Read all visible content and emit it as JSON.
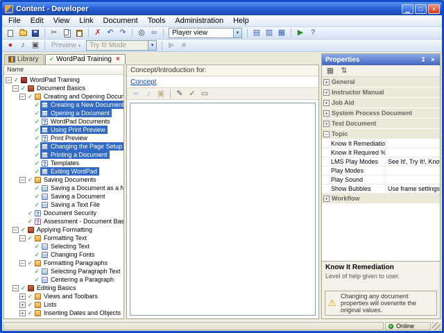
{
  "window": {
    "title": "Content - Developer",
    "controls": {
      "minimize": "▁",
      "maximize": "□",
      "close": "×"
    }
  },
  "colors": {
    "selection": "#316AC5",
    "title_blue": "#2B63D8",
    "online_green": "#2DB52D",
    "warning_yellow": "#E0A010"
  },
  "menu": {
    "items": [
      {
        "label": "File"
      },
      {
        "label": "Edit"
      },
      {
        "label": "View"
      },
      {
        "label": "Link"
      },
      {
        "label": "Document"
      },
      {
        "label": "Tools"
      },
      {
        "label": "Administration"
      },
      {
        "label": "Help"
      }
    ]
  },
  "toolbar_standard": {
    "items": [
      {
        "name": "new-document-icon",
        "shape": "page"
      },
      {
        "name": "open-icon",
        "shape": "folder"
      },
      {
        "name": "save-icon",
        "shape": "disk"
      },
      {
        "sep": true
      },
      {
        "name": "cut-icon",
        "glyph": "✂",
        "color": "#555555"
      },
      {
        "name": "copy-icon",
        "shape": "copy"
      },
      {
        "name": "paste-icon",
        "shape": "paste"
      },
      {
        "sep": true
      },
      {
        "name": "delete-icon",
        "glyph": "✗",
        "color": "#c03428"
      },
      {
        "name": "undo-icon",
        "glyph": "↶",
        "color": "#2a52be"
      },
      {
        "name": "redo-icon",
        "glyph": "↷",
        "color": "#2a52be"
      },
      {
        "sep": true
      },
      {
        "name": "find-icon",
        "glyph": "◎",
        "color": "#333333"
      },
      {
        "name": "link-icon",
        "glyph": "∞",
        "color": "#4a6fd4"
      },
      {
        "sep": true
      },
      {
        "combo": true,
        "name": "player-view-select",
        "value": "Player view",
        "width": 106
      },
      {
        "sep": true
      },
      {
        "name": "outline-view-icon",
        "glyph": "▤",
        "color": "#3a63b8"
      },
      {
        "name": "split-view-icon",
        "glyph": "▥",
        "color": "#3a63b8"
      },
      {
        "name": "grid-view-icon",
        "glyph": "▦",
        "color": "#3a63b8"
      },
      {
        "sep": true
      },
      {
        "name": "start-preview-icon",
        "glyph": "▶",
        "color": "#2f8a2f"
      },
      {
        "name": "help-icon",
        "glyph": "?",
        "color": "#2a52be"
      }
    ]
  },
  "toolbar_playback": {
    "items": [
      {
        "name": "record-topic-icon",
        "glyph": "●",
        "color": "#c03428"
      },
      {
        "name": "sound-recording-icon",
        "glyph": "♪",
        "color": "#2a52be"
      },
      {
        "name": "screenshot-icon",
        "glyph": "▣",
        "color": "#555555"
      },
      {
        "sep": true
      },
      {
        "labelbtn": true,
        "name": "preview-dropdown",
        "label": "Preview",
        "disabled": true
      },
      {
        "combo": true,
        "name": "play-mode-select",
        "value": "Try It! Mode",
        "width": 102,
        "disabled": true
      },
      {
        "sep": true
      },
      {
        "name": "play-icon",
        "glyph": "▶",
        "color": "#888888",
        "disabled": true
      },
      {
        "name": "stop-icon",
        "glyph": "■",
        "color": "#888888",
        "disabled": true
      }
    ]
  },
  "tabs": [
    {
      "label": "Library"
    },
    {
      "label": "WordPad Training"
    }
  ],
  "icons": {
    "check": "✓",
    "close": "×",
    "pin": "↧",
    "warning": "⚠"
  },
  "tree": {
    "header": "Name",
    "items": [
      {
        "label": "WordPad Training",
        "depth": 0,
        "toggle": "minus",
        "icon": "module",
        "check": true
      },
      {
        "label": "Document Basics",
        "depth": 1,
        "toggle": "minus",
        "icon": "section",
        "check": true
      },
      {
        "label": "Creating and Opening Documents",
        "depth": 2,
        "toggle": "minus",
        "icon": "lesson",
        "check": true
      },
      {
        "label": "Creating a New Document",
        "depth": 3,
        "icon": "topic",
        "check": true,
        "selected": true
      },
      {
        "label": "Opening a Document",
        "depth": 3,
        "icon": "topic",
        "check": true,
        "selected": true
      },
      {
        "label": "WordPad Documents",
        "depth": 3,
        "icon": "concept",
        "check": true
      },
      {
        "label": "Using Print Preview",
        "depth": 3,
        "icon": "topic",
        "check": true,
        "selected": true
      },
      {
        "label": "Print Preview",
        "depth": 3,
        "icon": "concept",
        "check": true
      },
      {
        "label": "Changing the Page Setup",
        "depth": 3,
        "icon": "topic",
        "check": true,
        "selected": true
      },
      {
        "label": "Printing a Document",
        "depth": 3,
        "icon": "topic",
        "check": true,
        "selected": true
      },
      {
        "label": "Templates",
        "depth": 3,
        "icon": "concept",
        "check": true
      },
      {
        "label": "Exiting WordPad",
        "depth": 3,
        "icon": "topic",
        "check": true,
        "selected": true
      },
      {
        "label": "Saving Documents",
        "depth": 2,
        "toggle": "minus",
        "icon": "lesson",
        "check": true
      },
      {
        "label": "Saving a Document as a New File",
        "depth": 3,
        "icon": "topic",
        "check": true
      },
      {
        "label": "Saving a Document",
        "depth": 3,
        "icon": "topic",
        "check": true
      },
      {
        "label": "Saving a Text File",
        "depth": 3,
        "icon": "topic",
        "check": true
      },
      {
        "label": "Document Security",
        "depth": 2,
        "icon": "concept",
        "check": true
      },
      {
        "label": "Assessment - Document Basics",
        "depth": 2,
        "icon": "assessment",
        "check": true
      },
      {
        "label": "Applying Formatting",
        "depth": 1,
        "toggle": "minus",
        "icon": "section",
        "check": true
      },
      {
        "label": "Formatting Text",
        "depth": 2,
        "toggle": "minus",
        "icon": "lesson",
        "check": true
      },
      {
        "label": "Selecting Text",
        "depth": 3,
        "icon": "topic",
        "check": true
      },
      {
        "label": "Changing Fonts",
        "depth": 3,
        "icon": "topic",
        "check": true
      },
      {
        "label": "Formatting Paragraphs",
        "depth": 2,
        "toggle": "minus",
        "icon": "lesson",
        "check": true
      },
      {
        "label": "Selecting Paragraph Text",
        "depth": 3,
        "icon": "topic",
        "check": true
      },
      {
        "label": "Centering a Paragraph",
        "depth": 3,
        "icon": "topic",
        "check": true
      },
      {
        "label": "Editing Basics",
        "depth": 1,
        "toggle": "minus",
        "icon": "section",
        "check": true
      },
      {
        "label": "Views and Toolbars",
        "depth": 2,
        "toggle": "plus",
        "icon": "lesson",
        "check": true
      },
      {
        "label": "Lists",
        "depth": 2,
        "toggle": "plus",
        "icon": "lesson",
        "check": true
      },
      {
        "label": "Inserting Dates and Objects",
        "depth": 2,
        "toggle": "plus",
        "icon": "lesson",
        "check": true
      }
    ]
  },
  "editor": {
    "header": "Concept/Introduction for:",
    "link": "Concept",
    "toolbar": [
      {
        "name": "insert-link-icon",
        "glyph": "∞",
        "color": "#4a6fd4",
        "disabled": true
      },
      {
        "name": "insert-sound-icon",
        "glyph": "♪",
        "color": "#2a52be",
        "disabled": true
      },
      {
        "name": "insert-image-icon",
        "glyph": "▣",
        "color": "#8a6a3a",
        "disabled": true
      },
      {
        "sep": true
      },
      {
        "name": "edit-icon",
        "glyph": "✎",
        "color": "#555555"
      },
      {
        "name": "spellcheck-icon",
        "glyph": "✓",
        "color": "#2f8a2f"
      },
      {
        "name": "comment-icon",
        "glyph": "▭",
        "color": "#666666"
      }
    ]
  },
  "properties": {
    "title": "Properties",
    "toolbar": [
      {
        "name": "categorized-icon",
        "glyph": "▦",
        "color": "#555555"
      },
      {
        "name": "alphabetical-icon",
        "glyph": "⇅",
        "color": "#555555"
      }
    ],
    "rows": [
      {
        "type": "category",
        "label": "General"
      },
      {
        "type": "category",
        "label": "Instructor Manual"
      },
      {
        "type": "category",
        "label": "Job Aid"
      },
      {
        "type": "category",
        "label": "System Process Document"
      },
      {
        "type": "category",
        "label": "Test Document"
      },
      {
        "type": "category",
        "label": "Topic",
        "expanded": true
      },
      {
        "type": "row",
        "name": "Know It Remediation",
        "value": ""
      },
      {
        "type": "row",
        "name": "Know It Required %",
        "value": ""
      },
      {
        "type": "row",
        "name": "LMS Play Modes",
        "value": "See It!, Try It!, Know It?"
      },
      {
        "type": "row",
        "name": "Play Modes",
        "value": ""
      },
      {
        "type": "row",
        "name": "Play Sound",
        "value": ""
      },
      {
        "type": "row",
        "name": "Show Bubbles",
        "value": "Use frame settings"
      },
      {
        "type": "category",
        "label": "Workflow"
      }
    ],
    "description": {
      "title": "Know It Remediation",
      "text": "Level of help given to user."
    },
    "warning": "Changing any document properties will overwrite the original values."
  },
  "status": {
    "online_label": "Online"
  }
}
